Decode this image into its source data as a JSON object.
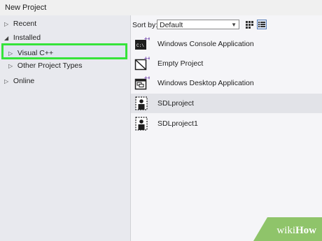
{
  "window": {
    "title": "New Project"
  },
  "tree": {
    "items": [
      {
        "label": "Recent",
        "arrow": "▷"
      },
      {
        "label": "Installed",
        "arrow": "◢"
      },
      {
        "label": "Visual C++",
        "arrow": "▷"
      },
      {
        "label": "Other Project Types",
        "arrow": "▷"
      },
      {
        "label": "Online",
        "arrow": "▷"
      }
    ]
  },
  "toolbar": {
    "sort_label": "Sort by:",
    "sort_value": "Default"
  },
  "templates": [
    {
      "name": "Windows Console Application",
      "icon": "console-app-icon",
      "selected": false
    },
    {
      "name": "Empty Project",
      "icon": "empty-project-icon",
      "selected": false
    },
    {
      "name": "Windows Desktop Application",
      "icon": "desktop-app-icon",
      "selected": false
    },
    {
      "name": "SDLproject",
      "icon": "sdl-project-icon",
      "selected": true
    },
    {
      "name": "SDLproject1",
      "icon": "sdl-project-icon",
      "selected": false
    }
  ],
  "watermark": {
    "wiki": "wiki",
    "how": "How"
  },
  "colors": {
    "highlight": "#35e33a",
    "watermark_green": "#8fc46a"
  }
}
